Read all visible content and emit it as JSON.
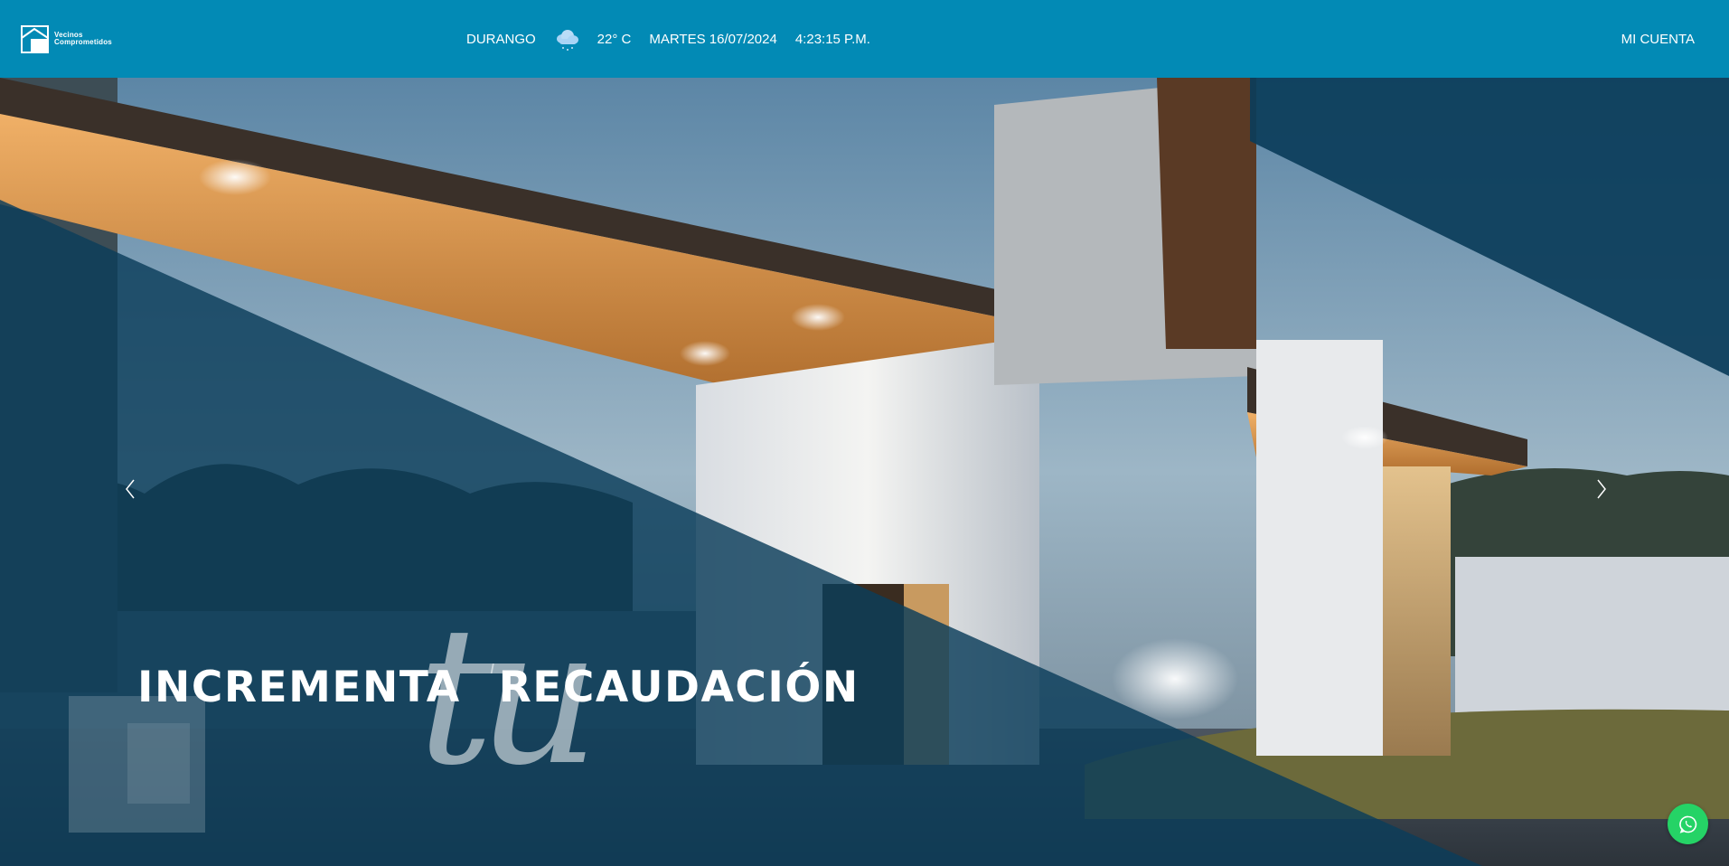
{
  "header": {
    "logo": {
      "line1": "Vecinos",
      "line2": "Comprometidos",
      "icon": "house-logo-icon"
    },
    "city": "DURANGO",
    "weather_icon": "rain-cloud-icon",
    "temperature": "22° C",
    "date": "MARTES 16/07/2024",
    "time": "4:23:15 P.M.",
    "account_label": "MI CUENTA"
  },
  "hero": {
    "headline_word1": "INCREMENTA",
    "script_word": "tu",
    "headline_word2": "RECAUDACIÓN",
    "prev_icon": "chevron-left-icon",
    "next_icon": "chevron-right-icon"
  },
  "floating": {
    "whatsapp_icon": "whatsapp-icon"
  },
  "colors": {
    "header_bg": "#028ab5",
    "overlay": "#0b3d5a",
    "whatsapp": "#25d366"
  }
}
